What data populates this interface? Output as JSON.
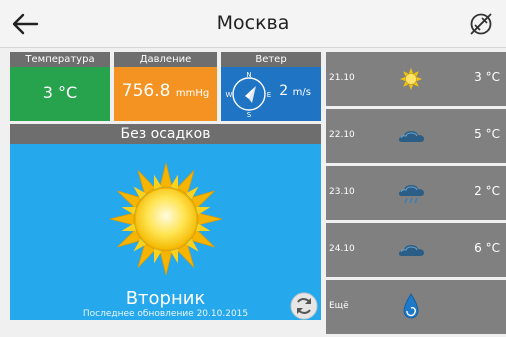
{
  "header": {
    "title": "Москва"
  },
  "tiles": {
    "temperature": {
      "label": "Температура",
      "value": "3 °C"
    },
    "pressure": {
      "label": "Давление",
      "value": "756.8",
      "unit": "mmHg"
    },
    "wind": {
      "label": "Ветер",
      "value": "2",
      "unit": "m/s",
      "compass": {
        "n": "N",
        "s": "S",
        "w": "W",
        "e": "E"
      }
    }
  },
  "current": {
    "condition": "Без осадков",
    "weekday": "Вторник",
    "updated": "Последнее обновление 20.10.2015"
  },
  "forecast": [
    {
      "date": "21.10",
      "icon": "sun-icon",
      "temp": "3 °C"
    },
    {
      "date": "22.10",
      "icon": "cloud-icon",
      "temp": "5 °C"
    },
    {
      "date": "23.10",
      "icon": "rain-cloud-icon",
      "temp": "2 °C"
    },
    {
      "date": "24.10",
      "icon": "cloud-icon",
      "temp": "6 °C"
    }
  ],
  "more": {
    "label": "Ещё",
    "icon": "water-drop-icon"
  },
  "colors": {
    "temperature_tile": "#27a24d",
    "pressure_tile": "#f49222",
    "wind_tile": "#2074c4",
    "main_panel": "#26a8ec",
    "header_strip": "#6e6e6e",
    "forecast_row": "#808080"
  }
}
